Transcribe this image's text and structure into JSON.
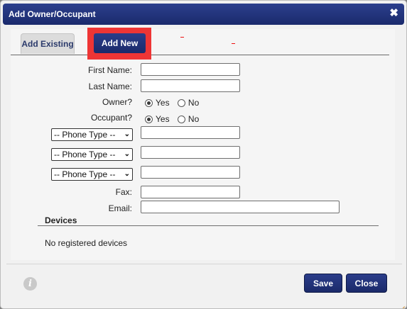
{
  "dialog": {
    "title": "Add Owner/Occupant",
    "close_glyph": "✖"
  },
  "tabs": [
    {
      "label": "Add Existing",
      "active": false
    },
    {
      "label": "Add New",
      "active": true
    }
  ],
  "form": {
    "first_name_label": "First Name:",
    "last_name_label": "Last Name:",
    "owner_label": "Owner?",
    "occupant_label": "Occupant?",
    "owner_options": [
      "Yes",
      "No"
    ],
    "owner_selected": "Yes",
    "occupant_options": [
      "Yes",
      "No"
    ],
    "occupant_selected": "Yes",
    "phone_type_placeholder": "-- Phone Type --",
    "fax_label": "Fax:",
    "email_label": "Email:"
  },
  "devices": {
    "title": "Devices",
    "empty_text": "No registered devices"
  },
  "footer": {
    "info_icon": "i",
    "save_label": "Save",
    "close_label": "Close"
  },
  "colors": {
    "titlebar": "#1f2f75",
    "button": "#22347a",
    "highlight": "#ee3535"
  }
}
